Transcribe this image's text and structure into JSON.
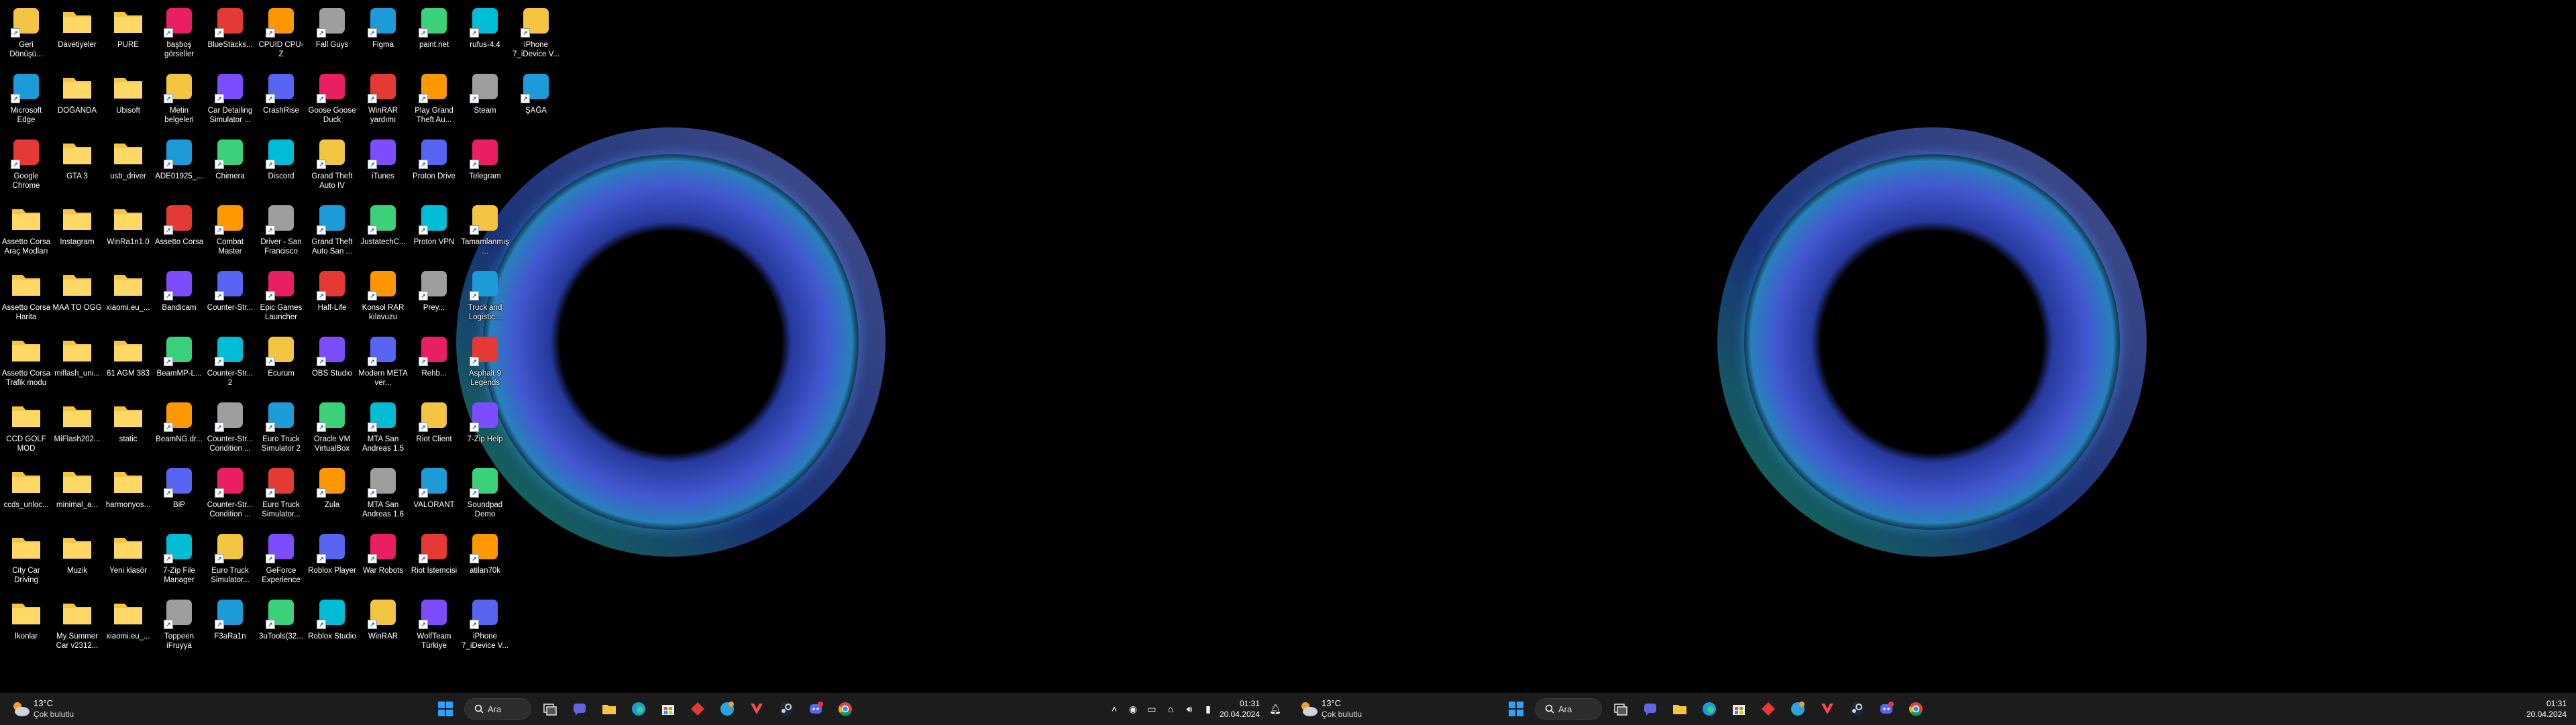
{
  "desktop": {
    "columns": [
      [
        "Geri Dönüşü...",
        "Microsoft Edge",
        "Google Chrome",
        "Assetto Corsa Araç Modları",
        "Assetto Corsa Harita",
        "Assetto Corsa Trafik modu",
        "CCD GOLF MOD",
        "ccds_unloc...",
        "City Car Driving",
        "İkonlar"
      ],
      [
        "Davetiyeler",
        "DOĞANDA",
        "GTA 3",
        "Instagram",
        "MAA TO OGG",
        "miflash_uni...",
        "MiFlash202...",
        "minimal_a...",
        "Muzik",
        "My Summer Car v2312..."
      ],
      [
        "PURE",
        "Ubisoft",
        "usb_driver",
        "WinRa1n1.0",
        "xiaomi.eu_...",
        "61 AGM 383",
        "static",
        "harmonyos...",
        "Yeni klasör",
        "xiaomi.eu_..."
      ],
      [
        "başboş görseller",
        "Metin belgeleri",
        "ADE01925_...",
        "Assetto Corsa",
        "Bandicam",
        "BeamMP-L...",
        "BeamNG.dr...",
        "BiP",
        "7-Zip File Manager",
        "Toppeen iFruyya"
      ],
      [
        "BlueStacks...",
        "Car Detailing Simulator ...",
        "Chimera",
        "Combat Master",
        "Counter-Str...",
        "Counter-Str... 2",
        "Counter-Str... Condition ...",
        "Counter-Str... Condition ...",
        "Euro Truck Simulator...",
        "F3aRa1n"
      ],
      [
        "CPUID CPU-Z",
        "CrashRise",
        "Discord",
        "Driver - San Francisco",
        "Epic Games Launcher",
        "Ecurum",
        "Euro Truck Simulator 2",
        "Euro Truck Simulator...",
        "GeForce Experience",
        "3uTools(32..."
      ],
      [
        "Fall Guys",
        "Goose Goose Duck",
        "Grand Theft Auto IV",
        "Grand Theft Auto San ...",
        "Half-Life",
        "OBS Studio",
        "Oracle VM VirtualBox",
        "Zula",
        "Roblox Player",
        "Roblox Studio"
      ],
      [
        "Figma",
        "WinRAR yardımı",
        "iTunes",
        "JustatechC...",
        "Konsol RAR kılavuzu",
        "Modern META ver...",
        "MTA San Andreas 1.5",
        "MTA San Andreas 1.6",
        "War Robots",
        "WinRAR"
      ],
      [
        "paint.net",
        "Play Grand Theft Au...",
        "Proton Drive",
        "Proton VPN",
        "Prey...",
        "Rehb...",
        "Riot Client",
        "VALORANT",
        "Riot İstemcisi",
        "WolfTeam Türkiye"
      ],
      [
        "rufus-4.4",
        "Steam",
        "Telegram",
        "Tamamlanmış...",
        "Truck and Logistic...",
        "Asphalt 9 Legends",
        "7-Zip Help",
        "Soundpad Demo",
        "atilan70k",
        "iPhone 7_iDevice V..."
      ],
      [
        "iPhone 7_iDevice V...",
        "ŞAĞA"
      ]
    ]
  },
  "taskbar_left": {
    "weather_temp": "13°C",
    "weather_desc": "Çok bulutlu",
    "search_label": "Ara",
    "clock_time": "01:31",
    "clock_date": "20.04.2024"
  },
  "taskbar_right": {
    "weather_temp": "13°C",
    "weather_desc": "Çok bulutlu",
    "search_label": "Ara",
    "clock_time": "01:31",
    "clock_date": "20.04.2024"
  },
  "icons": {
    "start": "windows-start-icon",
    "search": "search-icon",
    "task_view": "task-view-icon",
    "apps": [
      "teams-chat-icon",
      "file-explorer-icon",
      "edge-icon",
      "store-icon",
      "app-diamond-icon",
      "telegram-icon",
      "valorant-icon",
      "steam-icon",
      "discord-icon",
      "chrome-icon"
    ]
  },
  "colors": {
    "taskbar_bg": "#1c1c1c",
    "folder": "#f4c542",
    "accent": "#0a64d8"
  }
}
